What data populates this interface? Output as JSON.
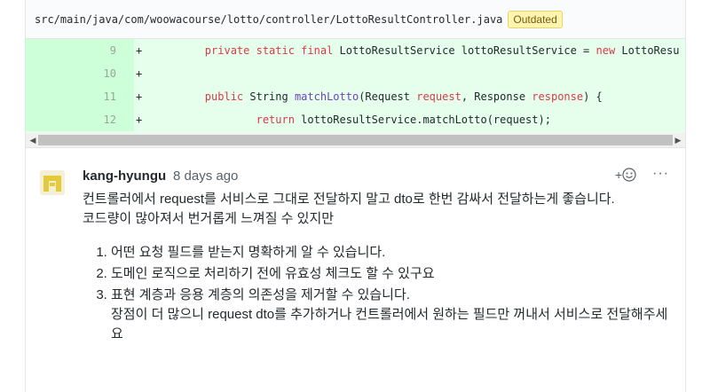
{
  "file": {
    "path": "src/main/java/com/woowacourse/lotto/controller/LottoResultController.java",
    "status_badge": "Outdated"
  },
  "diff_lines": [
    {
      "num": "9",
      "sign": "+",
      "parts": [
        {
          "t": "        ",
          "c": ""
        },
        {
          "t": "private static final",
          "c": "kw"
        },
        {
          "t": " LottoResultService lottoResultService = ",
          "c": ""
        },
        {
          "t": "new",
          "c": "kw"
        },
        {
          "t": " LottoResu",
          "c": ""
        }
      ]
    },
    {
      "num": "10",
      "sign": "+",
      "parts": []
    },
    {
      "num": "11",
      "sign": "+",
      "parts": [
        {
          "t": "        ",
          "c": ""
        },
        {
          "t": "public",
          "c": "kw"
        },
        {
          "t": " String ",
          "c": ""
        },
        {
          "t": "matchLotto",
          "c": "fn"
        },
        {
          "t": "(Request ",
          "c": ""
        },
        {
          "t": "request",
          "c": "kw"
        },
        {
          "t": ", Response ",
          "c": ""
        },
        {
          "t": "response",
          "c": "kw"
        },
        {
          "t": ") {",
          "c": ""
        }
      ]
    },
    {
      "num": "12",
      "sign": "+",
      "parts": [
        {
          "t": "                ",
          "c": ""
        },
        {
          "t": "return",
          "c": "kw"
        },
        {
          "t": " lottoResultService.matchLotto(request);",
          "c": ""
        }
      ]
    }
  ],
  "scrollbar": {
    "left_arrow": "◀",
    "right_arrow": "▶"
  },
  "comment": {
    "author": "kang-hyungu",
    "time": "8 days ago",
    "reaction_label": "+",
    "reaction_icon": "smiley-icon",
    "more_label": "···",
    "paragraphs": [
      "컨트롤러에서 request를 서비스로 그대로 전달하지 말고 dto로 한번 감싸서 전달하는게 좋습니다.",
      "코드량이 많아져서 번거롭게 느껴질 수 있지만"
    ],
    "list": [
      "어떤 요청 필드를 받는지 명확하게 알 수 있습니다.",
      "도메인 로직으로 처리하기 전에 유효성 체크도 할 수 있구요",
      "표현 계층과 응용 계층의 의존성을 제거할 수 있습니다."
    ],
    "list_item3_continuation": "장점이 더 많으니 request dto를 추가하거나 컨트롤러에서 원하는 필드만 꺼내서 서비스로 전달해주세요"
  },
  "colors": {
    "addition_bg": "#e6ffed",
    "addition_num_bg": "#cdffd8",
    "keyword": "#d73a49",
    "function": "#6f42c1",
    "badge_bg": "#fff5b1"
  }
}
